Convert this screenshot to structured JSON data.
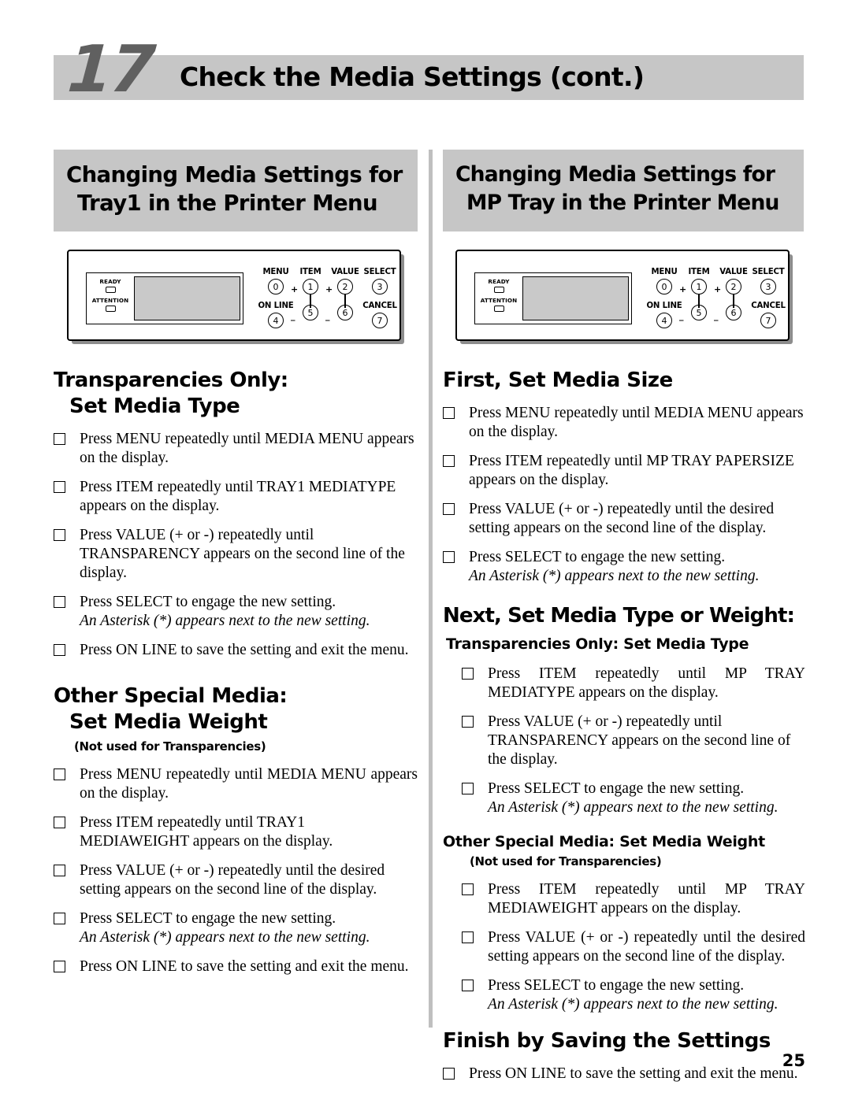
{
  "header": {
    "step_number": "17",
    "title": "Check the Media Settings (cont.)",
    "band_color": "#c6c6c6",
    "number_color": "#606060"
  },
  "control_panel": {
    "led_ready": "READY",
    "led_attention": "ATTENTION",
    "keys": {
      "menu_label": "MENU",
      "menu_number": "0",
      "item_label": "ITEM",
      "item_plus_number": "1",
      "item_minus_number": "5",
      "value_label": "VALUE",
      "value_plus_number": "2",
      "value_minus_number": "6",
      "select_label": "SELECT",
      "select_number": "3",
      "online_label": "ON LINE",
      "online_number": "4",
      "cancel_label": "CANCEL",
      "cancel_number": "7",
      "plus_sign": "+",
      "minus_sign": "_"
    }
  },
  "left_column": {
    "banner_line1": "Changing Media Settings for",
    "banner_line2": "Tray1 in the Printer Menu",
    "section1": {
      "heading_line1": "Transparencies Only:",
      "heading_line2": "Set Media Type",
      "steps": [
        {
          "text": "Press MENU repeatedly until MEDIA MENU  appears on the display."
        },
        {
          "text": "Press ITEM repeatedly until TRAY1 MEDIATYPE appears on the display."
        },
        {
          "text": "Press VALUE (+ or -) repeatedly until TRANSPARENCY appears on the second line of the display."
        },
        {
          "text": "Press SELECT to engage the new setting.",
          "note": "An Asterisk (*) appears next to the new setting."
        },
        {
          "text": "Press ON LINE to save the setting and exit the menu."
        }
      ]
    },
    "section2": {
      "heading_line1": "Other Special Media:",
      "heading_line2": "Set Media Weight",
      "heading_note": "(Not used for Transparencies)",
      "steps": [
        {
          "text": "Press MENU repeatedly until MEDIA MENU  appears on the display."
        },
        {
          "text": "Press ITEM repeatedly until TRAY1 MEDIAWEIGHT appears on the display."
        },
        {
          "text": "Press VALUE (+ or -) repeatedly until the desired setting appears on the second line of the display."
        },
        {
          "text": "Press SELECT to engage the new setting.",
          "note": "An Asterisk (*) appears next to the new setting."
        },
        {
          "text": "Press ON LINE to save the setting and exit the menu."
        }
      ]
    }
  },
  "right_column": {
    "banner_line1": "Changing Media Settings for",
    "banner_line2": "MP Tray in the Printer Menu",
    "section1": {
      "heading": "First, Set Media Size",
      "steps": [
        {
          "text": "Press MENU repeatedly until MEDIA MENU appears on the display."
        },
        {
          "text": "Press ITEM repeatedly until MP TRAY PAPERSIZE appears on the display."
        },
        {
          "text": "Press VALUE (+ or -) repeatedly until the desired setting appears on the second line of the display."
        },
        {
          "text": "Press SELECT to engage the new setting.",
          "note": "An Asterisk (*) appears next to the new setting."
        }
      ]
    },
    "section2": {
      "heading": "Next, Set Media Type or Weight:",
      "sub1": {
        "heading": "Transparencies Only: Set Media Type",
        "steps": [
          {
            "text": "Press ITEM repeatedly until MP TRAY MEDIATYPE appears on the display."
          },
          {
            "text": "Press VALUE (+ or -) repeatedly until TRANSPARENCY appears on the second line of the display."
          },
          {
            "text": "Press SELECT to engage the new setting.",
            "note": "An Asterisk (*) appears next to the new setting."
          }
        ]
      },
      "sub2": {
        "heading": "Other Special Media: Set Media Weight",
        "heading_note": "(Not used for Transparencies)",
        "steps": [
          {
            "text": "Press ITEM repeatedly until MP TRAY MEDIAWEIGHT appears on the display."
          },
          {
            "text": "Press VALUE (+ or -) repeatedly until the desired setting appears on the second line of the display."
          },
          {
            "text": "Press SELECT to engage the new setting.",
            "note": "An Asterisk (*) appears next to the new setting."
          }
        ]
      }
    },
    "section3": {
      "heading": "Finish by Saving the Settings",
      "steps": [
        {
          "text": "Press ON LINE to save the setting and exit the menu."
        }
      ]
    }
  },
  "footer": {
    "page_number": "25"
  }
}
